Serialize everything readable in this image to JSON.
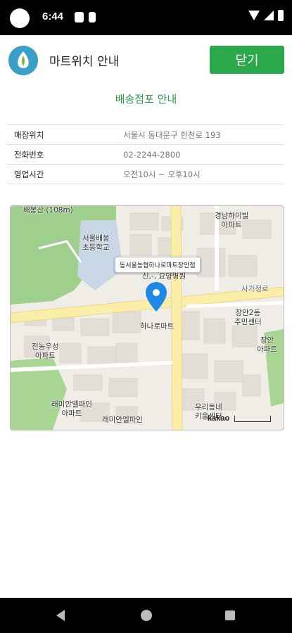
{
  "status_bar": {
    "time": "6:44"
  },
  "app_bar": {
    "title": "마트위치 안내",
    "close_label": "닫기"
  },
  "section": {
    "title": "배송점포 안내"
  },
  "info_rows": [
    {
      "label": "매장위치",
      "value": "서울시 동대문구 한천로 193"
    },
    {
      "label": "전화번호",
      "value": "02-2244-2800"
    },
    {
      "label": "영업시간",
      "value": "오전10시 ~ 오후10시"
    }
  ],
  "map": {
    "tooltip": "동서울농협하나로마트장안점",
    "attribution": "kakao",
    "labels": {
      "school": "서울배봉\n초등학교",
      "hospital": "신,-, 요양병원",
      "road": "사가정로",
      "apt1": "경남하이빌\n아파트",
      "center": "장안2동\n주민센터",
      "mart": "하나로마트",
      "apt2": "전농우성\n아파트",
      "apt3": "래미안엘파인\n아파트",
      "apt4": "래미안엘파인",
      "apt5": "우리동네\n키움센터",
      "apt6": "장안\n아파트",
      "park": "배봉산\n(108m)"
    }
  }
}
